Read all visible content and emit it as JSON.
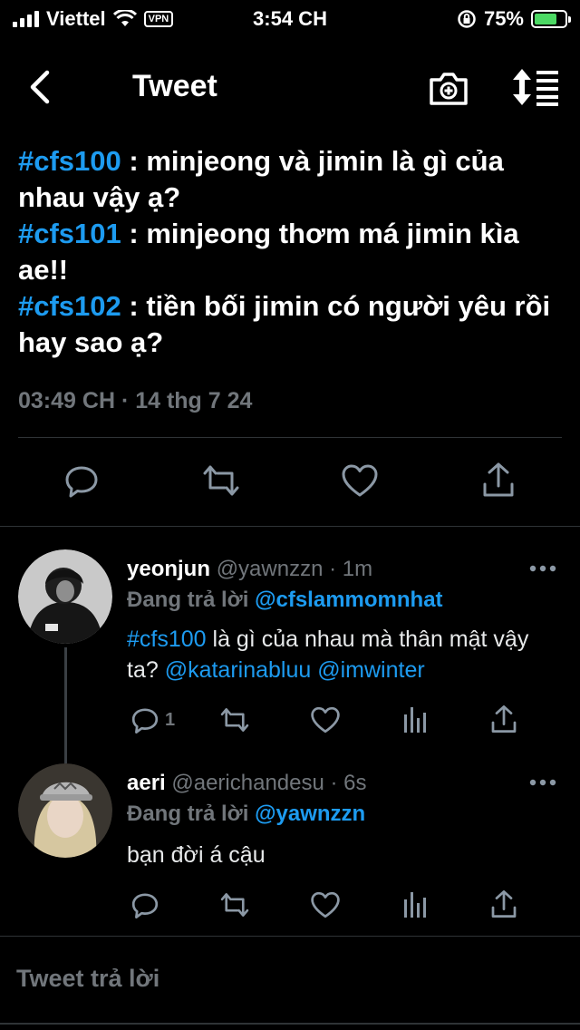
{
  "status_bar": {
    "carrier": "Viettel",
    "vpn_label": "VPN",
    "time": "3:54 CH",
    "battery_pct": "75%",
    "battery_level": 0.75,
    "icons": [
      "signal-icon",
      "wifi-icon",
      "rotation-lock-icon",
      "battery-icon"
    ]
  },
  "nav": {
    "title": "Tweet",
    "icons": [
      "back-icon",
      "camera-plus-icon",
      "sort-icon"
    ]
  },
  "main_tweet": {
    "lines": [
      {
        "tag": "#cfs100",
        "text": " : minjeong và jimin là gì của nhau vậy ạ?"
      },
      {
        "tag": "#cfs101",
        "text": " : minjeong thơm má jimin kìa ae!!"
      },
      {
        "tag": "#cfs102",
        "text": " : tiền bối jimin có người yêu rồi hay sao ạ?"
      }
    ],
    "timestamp": "03:49 CH · 14 thg 7 24"
  },
  "replies": [
    {
      "name": "yeonjun",
      "handle": "@yawnzzn",
      "time": " · 1m",
      "replying_label": "Đang trả lời ",
      "replying_to": "@cfslammomnhat",
      "body_tag": "#cfs100",
      "body_text": " là gì của nhau mà thân mật vậy ta? ",
      "mention1": "@katarinabluu",
      "mention2": "@imwinter",
      "reply_count": "1"
    },
    {
      "name": "aeri",
      "handle": "@aerichandesu",
      "time": " · 6s",
      "replying_label": "Đang trả lời ",
      "replying_to": "@yawnzzn",
      "body_text": "bạn đời á cậu"
    }
  ],
  "compose": {
    "placeholder": "Tweet trả lời"
  },
  "colors": {
    "accent": "#1d9bf0",
    "muted": "#71767b",
    "background": "#000000"
  }
}
